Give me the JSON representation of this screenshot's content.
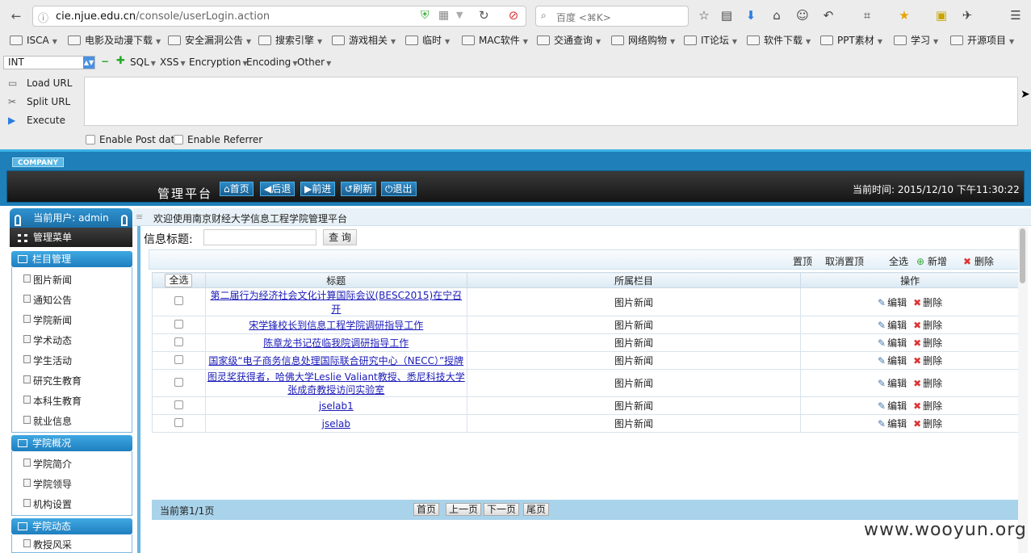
{
  "browser": {
    "url_host": "cie.njue.edu.cn",
    "url_path": "/console/userLogin.action",
    "search_placeholder": "百度 <⌘K>",
    "bookmarks": [
      "ISCA",
      "电影及动漫下载",
      "安全漏洞公告",
      "搜索引擎",
      "游戏相关",
      "临时",
      "MAC软件",
      "交通查询",
      "网络购物",
      "IT论坛",
      "软件下载",
      "PPT素材",
      "学习",
      "开源项目"
    ]
  },
  "hackbar": {
    "select_value": "INT",
    "menus": [
      "SQL",
      "XSS",
      "Encryption",
      "Encoding",
      "Other"
    ],
    "load_url": "Load URL",
    "split_url": "Split URL",
    "execute": "Execute",
    "enable_post": "Enable Post data",
    "enable_referrer": "Enable Referrer"
  },
  "header": {
    "company": "COMPANY",
    "platform": "管理平台",
    "buttons": [
      "首页",
      "后退",
      "前进",
      "刷新",
      "退出"
    ],
    "time": "当前时间:  2015/12/10 下午11:30:22"
  },
  "sidebar": {
    "current_user": "当前用户: admin",
    "menu_title": "管理菜单",
    "sections": [
      {
        "title": "栏目管理",
        "items": [
          "图片新闻",
          "通知公告",
          "学院新闻",
          "学术动态",
          "学生活动",
          "研究生教育",
          "本科生教育",
          "就业信息"
        ]
      },
      {
        "title": "学院概况",
        "items": [
          "学院简介",
          "学院领导",
          "机构设置"
        ]
      },
      {
        "title": "学院动态",
        "items": [
          "教授风采"
        ]
      }
    ]
  },
  "main": {
    "welcome": "欢迎使用南京财经大学信息工程学院管理平台",
    "search_label": "信息标题:",
    "query_button": "查 询",
    "toolbar": {
      "top": "置顶",
      "untop": "取消置顶",
      "select_all": "全选",
      "add": "新增",
      "delete": "删除"
    },
    "columns": {
      "select_all": "全选",
      "title": "标题",
      "category": "所属栏目",
      "ops": "操作"
    },
    "edit_label": "编辑",
    "delete_label": "删除",
    "rows": [
      {
        "title": "第二届行为经济社会文化计算国际会议(BESC2015)在宁召开",
        "category": "图片新闻"
      },
      {
        "title": "宋学锋校长到信息工程学院调研指导工作",
        "category": "图片新闻"
      },
      {
        "title": "陈章龙书记莅临我院调研指导工作",
        "category": "图片新闻"
      },
      {
        "title": "国家级“电子商务信息处理国际联合研究中心（NECC）”授牌",
        "category": "图片新闻"
      },
      {
        "title": "图灵奖获得者，哈佛大学Leslie Valiant教授、悉尼科技大学张成奇教授访问实验室",
        "category": "图片新闻"
      },
      {
        "title": "jselab1",
        "category": "图片新闻"
      },
      {
        "title": "jselab",
        "category": "图片新闻"
      }
    ],
    "pager": {
      "status": "当前第1/1页",
      "first": "首页",
      "prev": "上一页",
      "next": "下一页",
      "last": "尾页"
    }
  },
  "watermark": "www.wooyun.org"
}
